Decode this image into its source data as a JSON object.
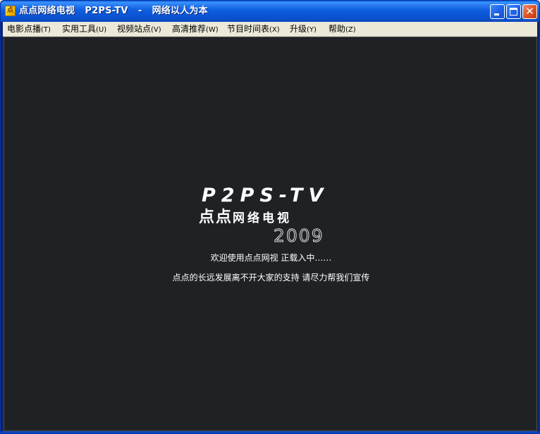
{
  "window": {
    "title": "点点网络电视   P2PS-TV   -   网络以人为本",
    "icon": "app-icon",
    "controls": {
      "minimize": "minimize-icon",
      "maximize": "maximize-icon",
      "close": "close-icon",
      "close_glyph": "✕"
    }
  },
  "menu": {
    "items": [
      {
        "label": "电影点播",
        "key": "(T)"
      },
      {
        "label": "实用工具",
        "key": "(U)"
      },
      {
        "label": "视频站点",
        "key": "(V)"
      },
      {
        "label": "高清推荐",
        "key": "(W)"
      },
      {
        "label": "节目时间表",
        "key": "(X)"
      },
      {
        "label": "升级",
        "key": "(Y)"
      },
      {
        "label": "帮助",
        "key": "(Z)"
      }
    ]
  },
  "splash": {
    "logo_en": "P2PS-TV",
    "logo_zh_big": "点点",
    "logo_zh_small": "网络电视",
    "logo_year": "2009",
    "status": "欢迎使用点点网视 正载入中……",
    "message": "点点的长远发展离不开大家的支持 请尽力帮我们宣传"
  },
  "colors": {
    "titlebar": "#0b55d6",
    "menubar": "#ece9d8",
    "content_bg": "#1e2224",
    "text": "#ffffff"
  }
}
